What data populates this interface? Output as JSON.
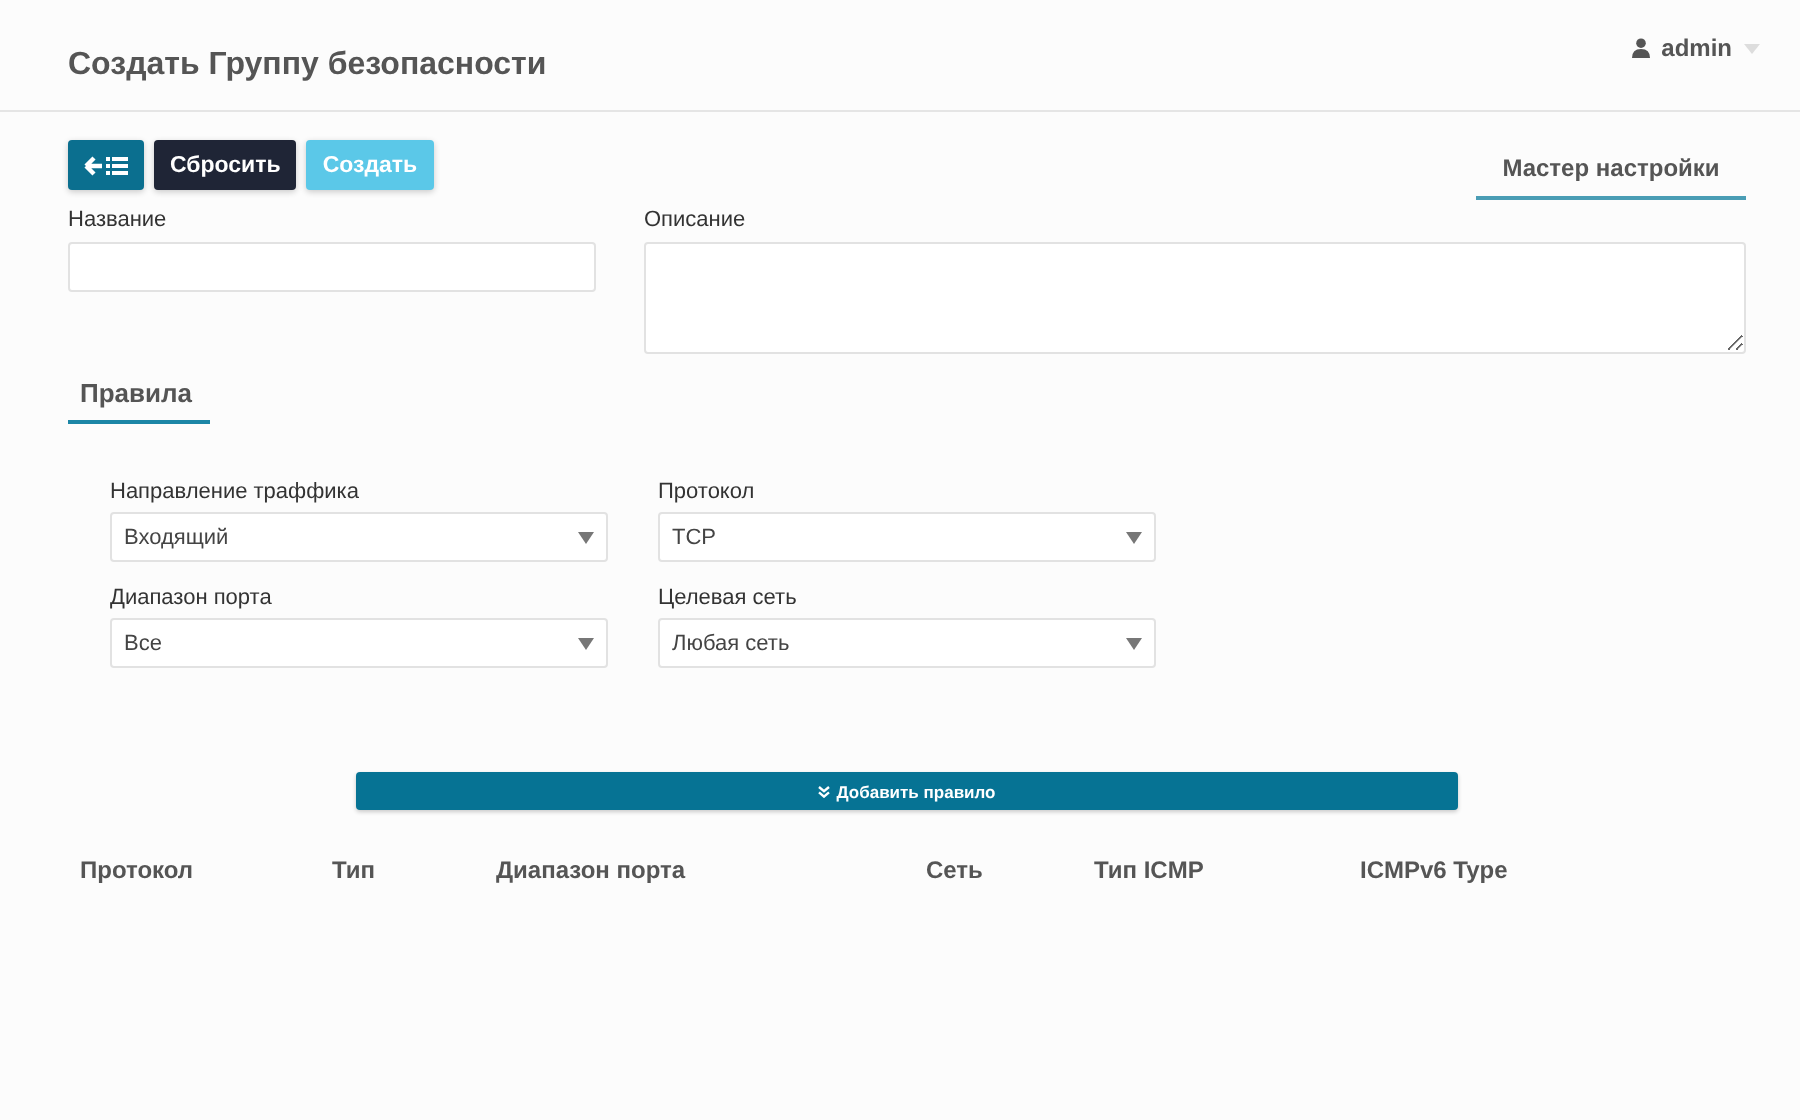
{
  "page_title": "Создать Группу безопасности",
  "user": {
    "name": "admin"
  },
  "toolbar": {
    "reset": "Сбросить",
    "create": "Создать",
    "create_disabled": true
  },
  "wizard_tabs": [
    {
      "label": "Мастер настройки",
      "selected": true
    }
  ],
  "fields": [
    {
      "label": "Название",
      "kind": "input"
    },
    {
      "label": "Описание",
      "kind": "textarea"
    }
  ],
  "section_tabs": [
    {
      "label": "Правила",
      "selected": true
    }
  ],
  "rule_selects": [
    {
      "label": "Направление траффика",
      "value": "Входящий"
    },
    {
      "label": "Протокол",
      "value": "TCP"
    },
    {
      "label": "Диапазон порта",
      "value": "Все"
    },
    {
      "label": "Целевая сеть",
      "value": "Любая сеть"
    }
  ],
  "add_rule_button": "Добавить правило",
  "table": {
    "columns": [
      "Протокол",
      "Тип",
      "Диапазон порта",
      "Сеть",
      "Тип ICMP",
      "ICMPv6 Type"
    ]
  }
}
